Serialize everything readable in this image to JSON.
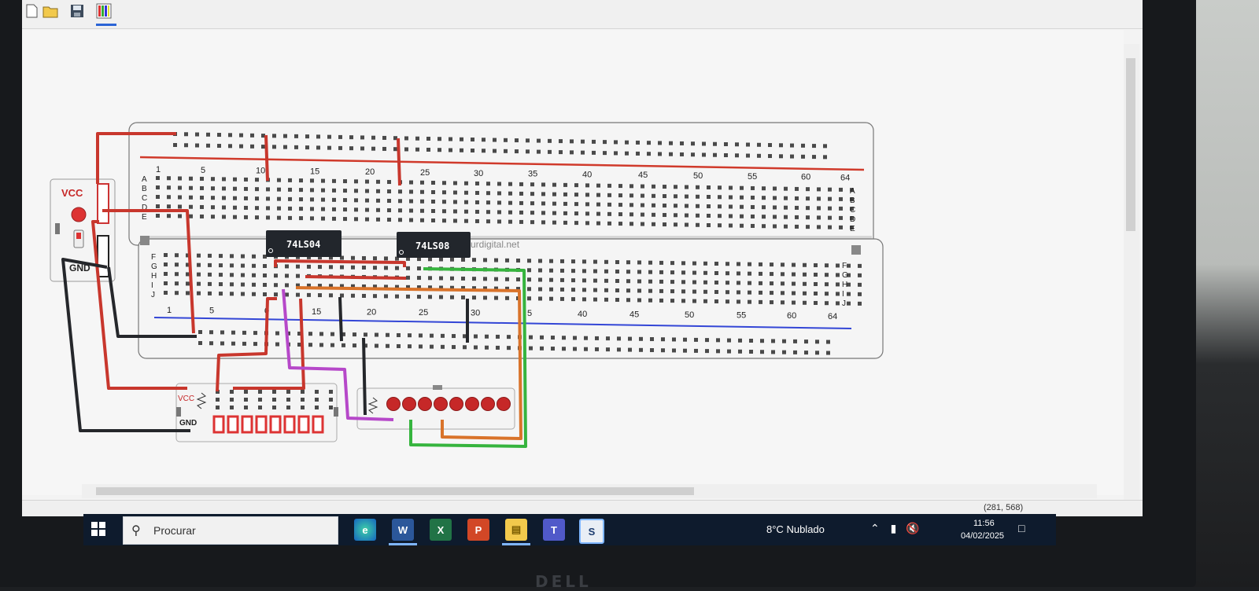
{
  "toolbar": {
    "icons": [
      "new-file-icon",
      "open-folder-icon",
      "save-icon",
      "components-palette-icon"
    ]
  },
  "breadboard": {
    "column_numbers": [
      "1",
      "5",
      "10",
      "15",
      "20",
      "25",
      "30",
      "35",
      "40",
      "45",
      "50",
      "55",
      "60",
      "64"
    ],
    "bottom_column_numbers": [
      "1",
      "5",
      "0",
      "15",
      "20",
      "25",
      "30",
      "5",
      "40",
      "45",
      "50",
      "55",
      "60",
      "64"
    ],
    "rows_top_left": [
      "A",
      "B",
      "C",
      "D",
      "E"
    ],
    "rows_top_right": [
      "A",
      "B",
      "C",
      "D",
      "E"
    ],
    "rows_bottom_left": [
      "F",
      "G",
      "H",
      "I",
      "J"
    ],
    "rows_bottom_right": [
      "F",
      "G",
      "H",
      "I",
      "J"
    ],
    "watermark": "urdigital.net",
    "colors": {
      "power_rail": "#d03a2b",
      "ground_rail": "#3346d6"
    }
  },
  "chips": [
    {
      "label": "74LS04"
    },
    {
      "label": "74LS08"
    }
  ],
  "power_module": {
    "vcc_label": "VCC",
    "gnd_label": "GND"
  },
  "switch_module": {
    "vcc_label": "VCC",
    "gnd_label": "GND"
  },
  "wire_colors": {
    "red": "#c8372d",
    "black": "#25272b",
    "purple": "#b648c9",
    "orange": "#d9732a",
    "green": "#36b43e",
    "led": "#c62828"
  },
  "status": {
    "coords": "(281, 568)"
  },
  "taskbar": {
    "search_placeholder": "Procurar",
    "apps": [
      "edge-icon",
      "word-icon",
      "excel-icon",
      "powerpoint-icon",
      "file-explorer-icon",
      "teams-icon",
      "simulator-icon"
    ],
    "weather_temp": "8°C",
    "weather_desc": "Nublado",
    "time": "11:56",
    "date": "04/02/2025"
  }
}
